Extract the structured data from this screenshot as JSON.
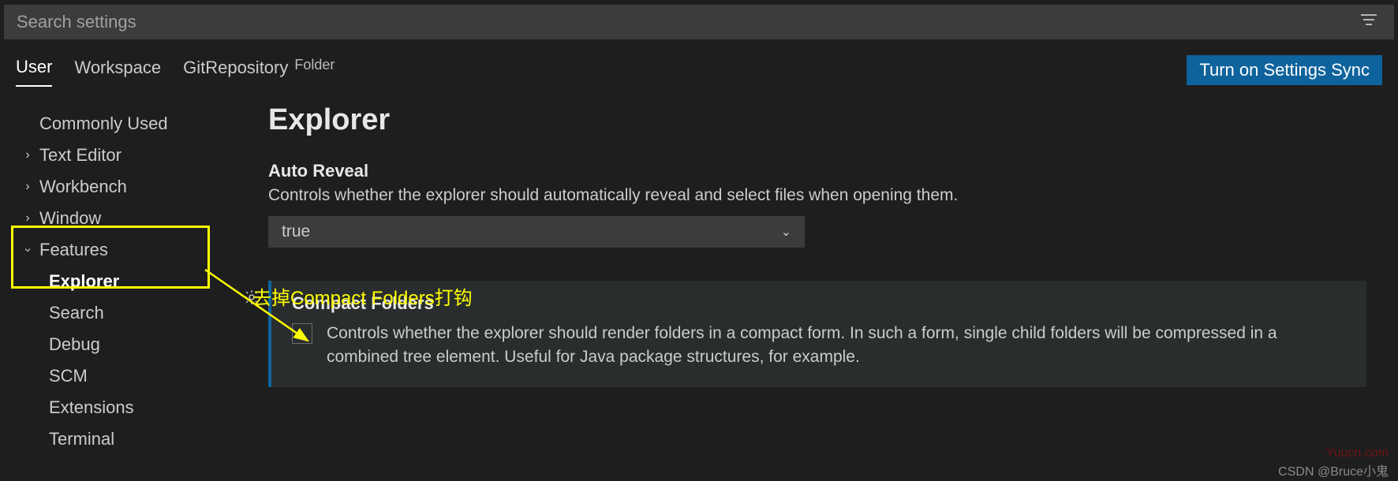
{
  "search": {
    "placeholder": "Search settings"
  },
  "tabs": {
    "user": "User",
    "workspace": "Workspace",
    "repo": "GitRepository",
    "repo_sub": "Folder"
  },
  "sync_button": "Turn on Settings Sync",
  "sidebar": {
    "commonly_used": "Commonly Used",
    "text_editor": "Text Editor",
    "workbench": "Workbench",
    "window": "Window",
    "features": "Features",
    "explorer": "Explorer",
    "search": "Search",
    "debug": "Debug",
    "scm": "SCM",
    "extensions": "Extensions",
    "terminal": "Terminal"
  },
  "content": {
    "heading": "Explorer",
    "auto_reveal": {
      "title": "Auto Reveal",
      "desc": "Controls whether the explorer should automatically reveal and select files when opening them.",
      "value": "true"
    },
    "compact_folders": {
      "title": "Compact Folders",
      "desc": "Controls whether the explorer should render folders in a compact form. In such a form, single child folders will be compressed in a combined tree element. Useful for Java package structures, for example."
    }
  },
  "annotation": "去掉Compact Folders打钩",
  "watermark1": "Yuucn.com",
  "watermark2": "CSDN @Bruce小鬼"
}
